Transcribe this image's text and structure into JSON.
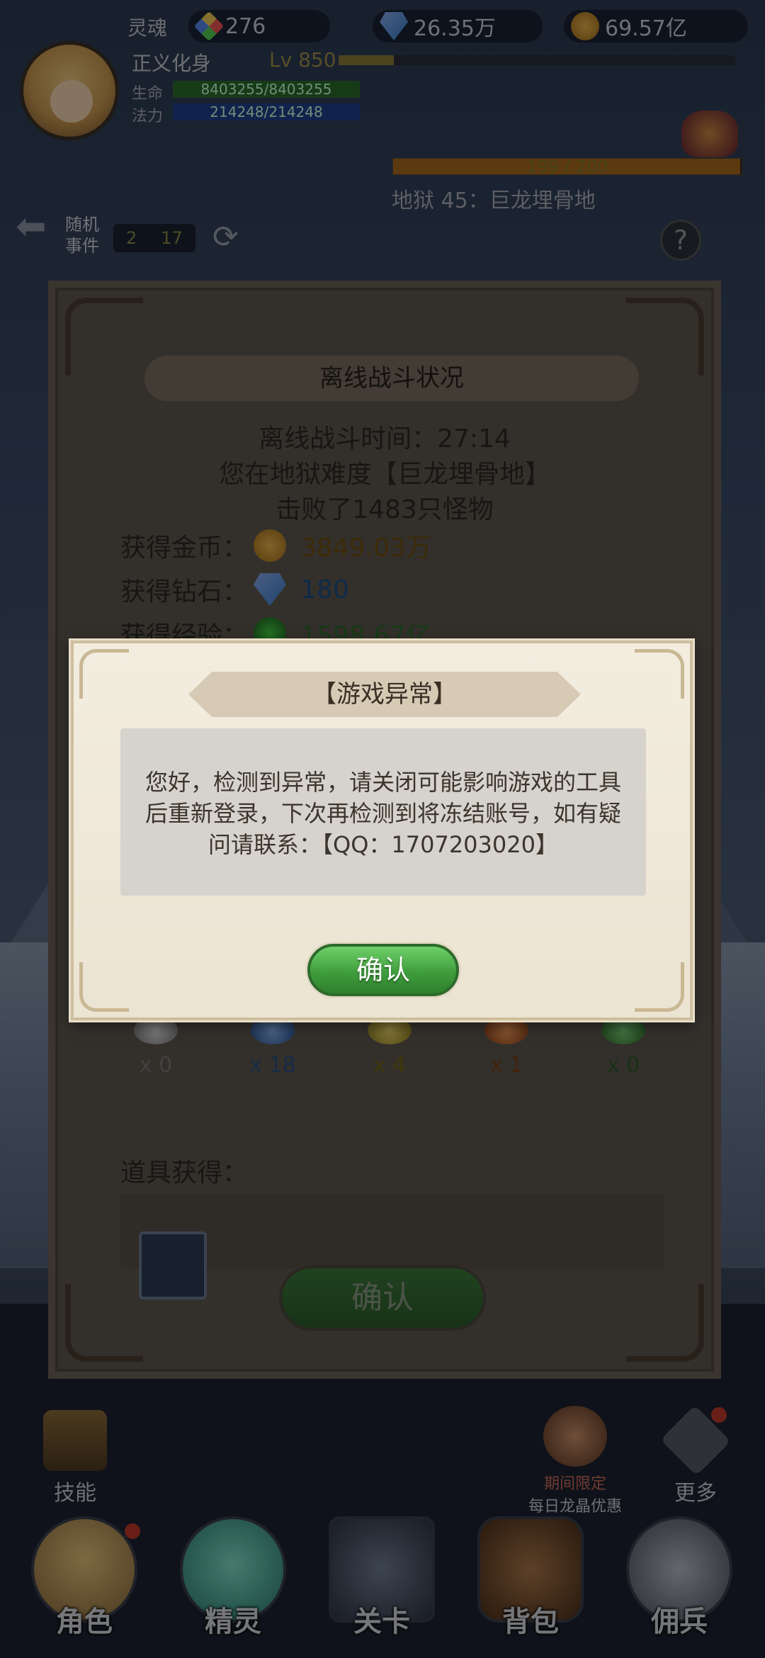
{
  "hud": {
    "soul_label": "灵魂",
    "gems": "276",
    "diamonds": "26.35万",
    "gold": "69.57亿",
    "player_name": "正义化身",
    "level": "Lv 850",
    "level_progress": 0.14,
    "hp": "8403255/8403255",
    "mp": "214248/214248",
    "hp_label": "生命",
    "mp_label": "法力"
  },
  "stage": {
    "boss_progress": "199 / 200",
    "boss_progress_fraction": 0.995,
    "name": "地狱 45：巨龙埋骨地"
  },
  "random_event": {
    "label_line1": "随机",
    "label_line2": "事件",
    "count_a": "2",
    "count_b": "17"
  },
  "offline_panel": {
    "title": "离线战斗状况",
    "time": "离线战斗时间：27:14",
    "difficulty": "您在地狱难度【巨龙埋骨地】",
    "kills": "击败了1483只怪物",
    "gold_label": "获得金币：",
    "gold_value": "3849.03万",
    "diamond_label": "获得钻石：",
    "diamond_value": "180",
    "exp_label": "获得经验：",
    "exp_value": "1598.67亿",
    "orbs": [
      {
        "count": "x 0",
        "color": "#cfcfcf"
      },
      {
        "count": "x 18",
        "color": "#4a7fd0"
      },
      {
        "count": "x 4",
        "color": "#d8c23a"
      },
      {
        "count": "x 1",
        "color": "#d66a2a"
      },
      {
        "count": "x 0",
        "color": "#4fb04a"
      }
    ],
    "drops_label": "道具获得：",
    "confirm": "确认"
  },
  "side": {
    "skill": "技能",
    "promo_line1": "期间限定",
    "promo_line2": "每日龙晶优惠",
    "more": "更多"
  },
  "nav": {
    "role": "角色",
    "spirit": "精灵",
    "stage": "关卡",
    "bag": "背包",
    "mercenary": "佣兵"
  },
  "dialog": {
    "title": "【游戏异常】",
    "message": "您好，检测到异常，请关闭可能影响游戏的工具后重新登录，下次再检测到将冻结账号，如有疑问请联系：【QQ：1707203020】",
    "confirm": "确认"
  },
  "colors": {
    "confirm_green": "#3f9d3c",
    "dialog_bg": "#f3ede0",
    "gold_text": "#6e4f10"
  }
}
